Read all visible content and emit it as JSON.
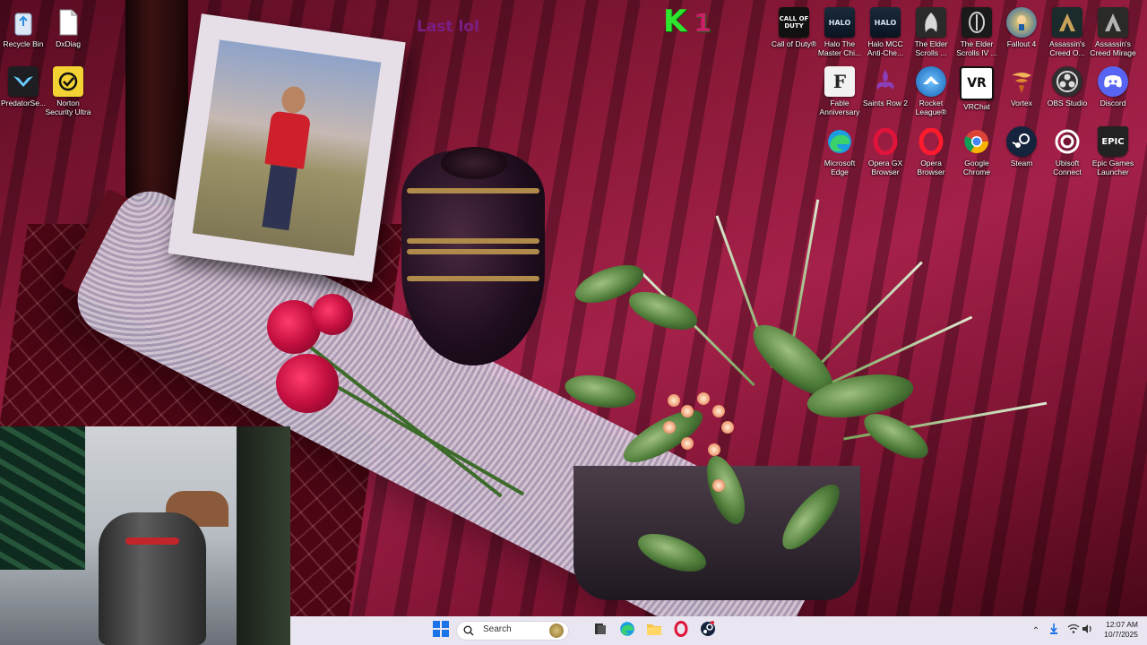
{
  "overlay": {
    "k_text": "K",
    "k_num": "1",
    "last_lol": "Last lol"
  },
  "desktop_icons_left": [
    {
      "label": "Recycle Bin",
      "icon": "recycle-bin-icon"
    },
    {
      "label": "DxDiag",
      "icon": "document-icon"
    },
    {
      "label": "PredatorSe...",
      "icon": "predator-icon"
    },
    {
      "label": "Norton Security Ultra",
      "icon": "norton-icon"
    }
  ],
  "desktop_icons_right": [
    {
      "label": "Call of Duty®",
      "icon": "cod-icon"
    },
    {
      "label": "Halo The Master Chi...",
      "icon": "halo-icon"
    },
    {
      "label": "Halo MCC Anti-Che...",
      "icon": "halo-mcc-icon"
    },
    {
      "label": "The Elder Scrolls ...",
      "icon": "elder-scrolls-icon"
    },
    {
      "label": "The Elder Scrolls IV ...",
      "icon": "oblivion-icon"
    },
    {
      "label": "Fallout 4",
      "icon": "fallout-icon"
    },
    {
      "label": "Assassin's Creed O...",
      "icon": "ac-odyssey-icon"
    },
    {
      "label": "Assassin's Creed Mirage",
      "icon": "ac-mirage-icon"
    },
    {
      "label": "Fable Anniversary",
      "icon": "fable-icon"
    },
    {
      "label": "Saints Row 2",
      "icon": "saints-row-icon"
    },
    {
      "label": "Rocket League®",
      "icon": "rocket-league-icon"
    },
    {
      "label": "VRChat",
      "icon": "vrchat-icon"
    },
    {
      "label": "Vortex",
      "icon": "vortex-icon"
    },
    {
      "label": "OBS Studio",
      "icon": "obs-icon"
    },
    {
      "label": "Discord",
      "icon": "discord-icon"
    },
    {
      "label": "Microsoft Edge",
      "icon": "edge-icon"
    },
    {
      "label": "Opera GX Browser",
      "icon": "opera-gx-icon"
    },
    {
      "label": "Opera Browser",
      "icon": "opera-icon"
    },
    {
      "label": "Google Chrome",
      "icon": "chrome-icon"
    },
    {
      "label": "Steam",
      "icon": "steam-icon"
    },
    {
      "label": "Ubisoft Connect",
      "icon": "ubisoft-icon"
    },
    {
      "label": "Epic Games Launcher",
      "icon": "epic-icon"
    }
  ],
  "icon_glyphs": {
    "cod": "CALL OF DUTY",
    "halo": "HALO",
    "halo_mcc": "HALO",
    "fable": "F",
    "vrchat": "VR",
    "epic": "EPIC"
  },
  "taskbar": {
    "search_placeholder": "Search",
    "time": "12:07 AM",
    "date": "10/7/2025"
  },
  "colors": {
    "taskbar_bg": "#e9e6f1",
    "windows_blue": "#1b73e8",
    "k_green": "#2ee62e"
  }
}
